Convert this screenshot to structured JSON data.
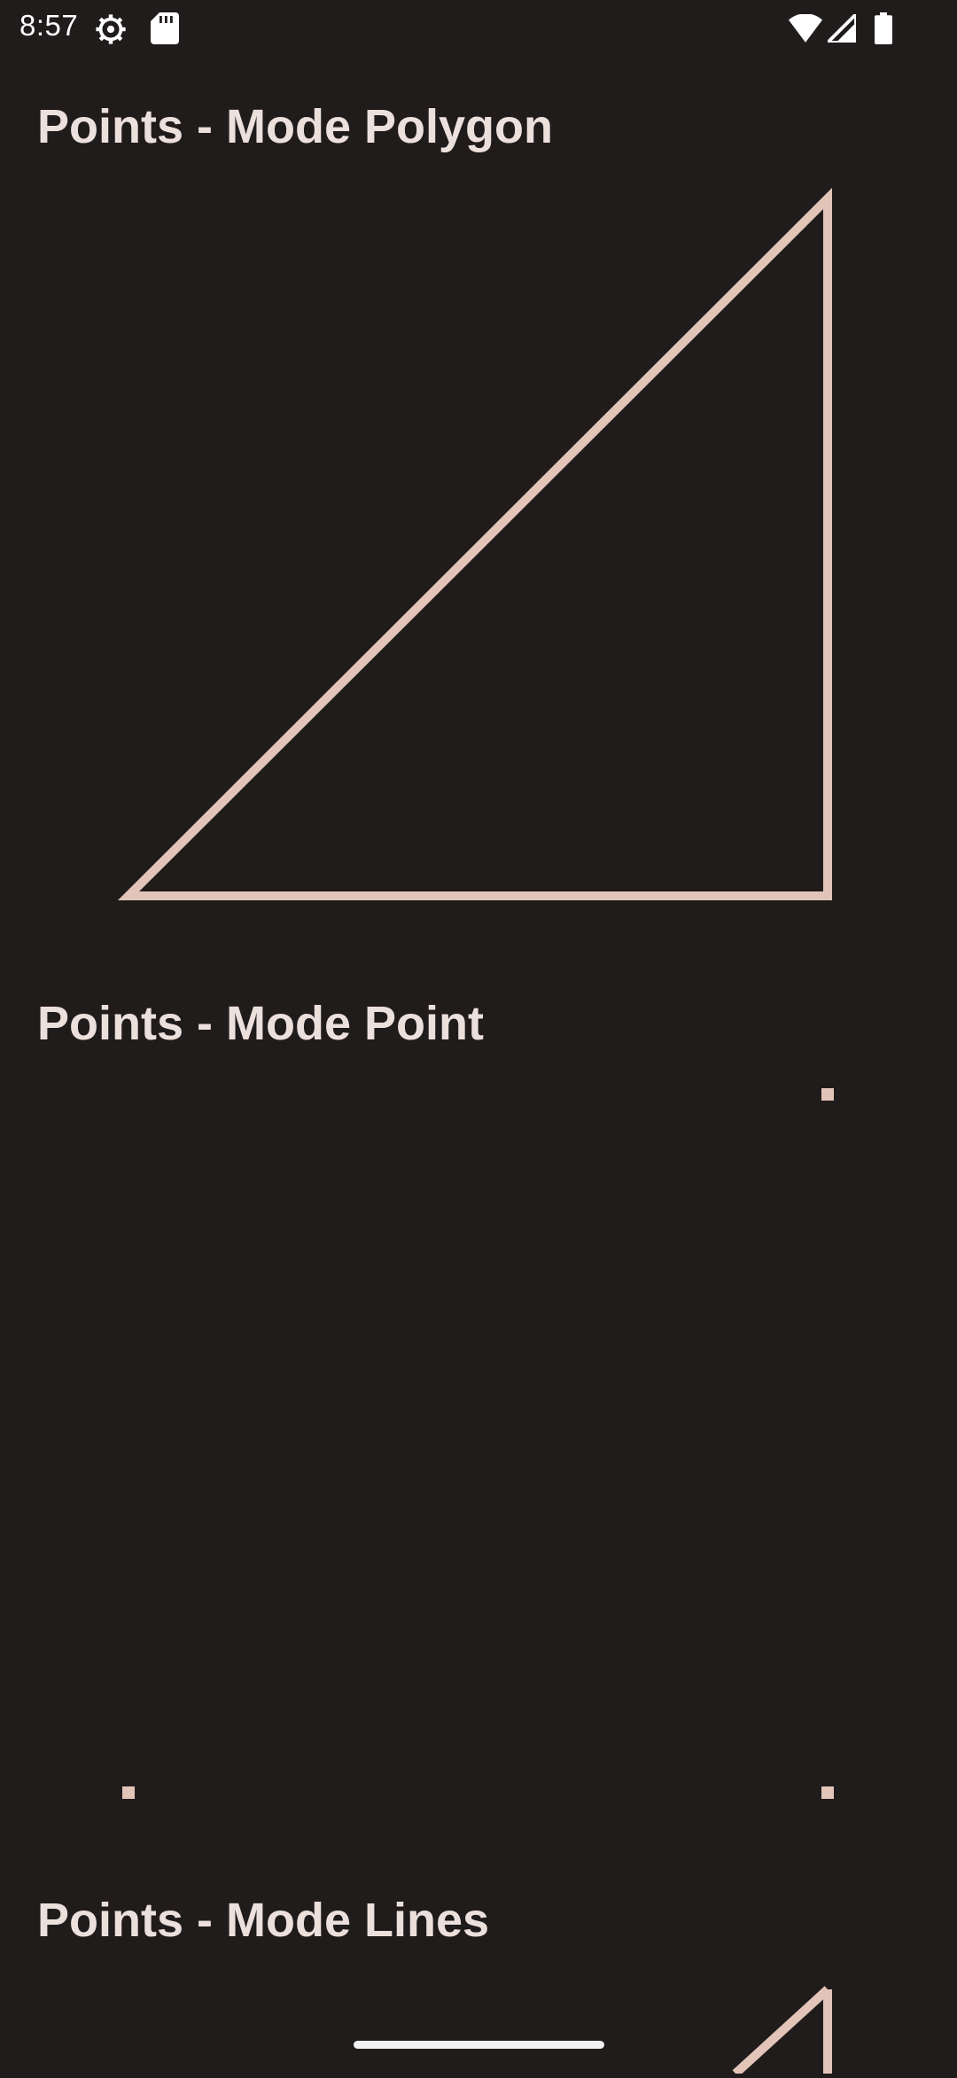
{
  "status_bar": {
    "time": "8:57",
    "left_icons": [
      "settings-icon",
      "sd-card-icon"
    ],
    "right_icons": [
      "wifi-icon",
      "cell-signal-icon",
      "battery-icon"
    ]
  },
  "sections": [
    {
      "title": "Points - Mode Polygon",
      "mode": "polygon"
    },
    {
      "title": "Points - Mode Point",
      "mode": "point"
    },
    {
      "title": "Points - Mode Lines",
      "mode": "lines"
    }
  ],
  "colors": {
    "background": "#201c1c",
    "stroke": "#e2c4b8",
    "title_text": "#ece0dc",
    "status_text": "#ffffff"
  }
}
